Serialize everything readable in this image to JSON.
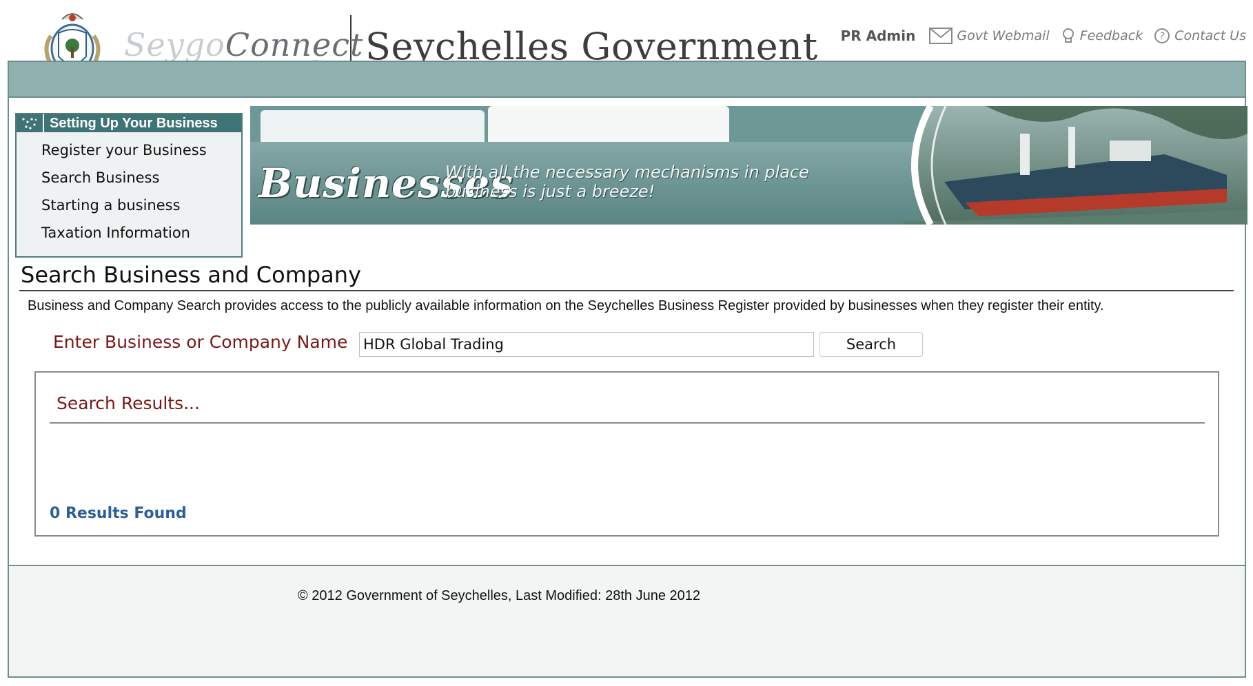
{
  "header": {
    "logo_light": "Seygo",
    "logo_dark": "onnect",
    "logo_c": "C",
    "title": "Seychelles Government",
    "links": {
      "pr_admin": "PR Admin",
      "webmail": "Govt Webmail",
      "feedback": "Feedback",
      "contact": "Contact Us"
    }
  },
  "sidebar": {
    "heading": "Setting Up Your Business",
    "items": [
      {
        "label": "Register your Business"
      },
      {
        "label": "Search Business"
      },
      {
        "label": "Starting a business"
      },
      {
        "label": "Taxation Information"
      }
    ]
  },
  "hero": {
    "word": "Businesses",
    "tagline_line1": "With all the necessary mechanisms in place",
    "tagline_line2": "business is just a breeze!"
  },
  "main": {
    "title": "Search Business and Company",
    "description": "Business and Company Search provides access to the publicly available information on the Seychelles Business Register provided by businesses when they register their entity.",
    "search": {
      "label": "Enter Business or Company Name",
      "value": "HDR Global Trading",
      "button": "Search"
    },
    "results": {
      "title": "Search Results...",
      "count": "0 Results Found"
    }
  },
  "footer": {
    "copyright": "© 2012 Government of Seychelles, Last Modified: 28th June 2012"
  },
  "colors": {
    "teal_bar": "#8eb0ae",
    "teal_dark": "#3f7476",
    "label_red": "#7a1717",
    "result_blue": "#2c5f9a"
  }
}
